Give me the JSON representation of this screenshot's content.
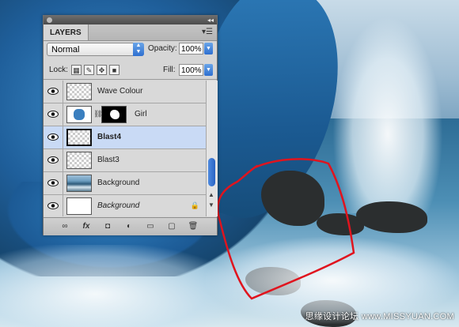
{
  "panel": {
    "tab_label": "LAYERS",
    "menu_icon": "panel-menu-icon",
    "collapse_icon": "collapse-icon",
    "blend_mode": "Normal",
    "opacity_label": "Opacity:",
    "opacity_value": "100%",
    "lock_label": "Lock:",
    "fill_label": "Fill:",
    "fill_value": "100%"
  },
  "layers": [
    {
      "name": "Wave Colour",
      "style": "normal",
      "thumb": "transparent",
      "selected": false
    },
    {
      "name": "Girl",
      "style": "normal",
      "thumb": "girl",
      "mask": true,
      "selected": false
    },
    {
      "name": "Blast4",
      "style": "bold",
      "thumb": "transparent",
      "selected": true
    },
    {
      "name": "Blast3",
      "style": "normal",
      "thumb": "transparent",
      "selected": false
    },
    {
      "name": "Background",
      "style": "normal",
      "thumb": "ocean",
      "selected": false
    },
    {
      "name": "Background",
      "style": "italic",
      "thumb": "blank",
      "locked": true,
      "selected": false
    }
  ],
  "bottom_tools": [
    "link-layers-icon",
    "fx-icon",
    "mask-icon",
    "adjustment-icon",
    "group-folder-icon",
    "new-layer-icon",
    "trash-icon"
  ],
  "bottom_tool_glyphs": [
    "∞",
    "fx",
    "◘",
    "◐",
    "▭",
    "▢",
    "🗑"
  ],
  "watermark": "思缘设计论坛 www.MISSYUAN.COM",
  "colors": {
    "annotation_red": "#e0141e",
    "selection_blue": "#c9daf5",
    "scroll_blue": "#2a64c5"
  }
}
